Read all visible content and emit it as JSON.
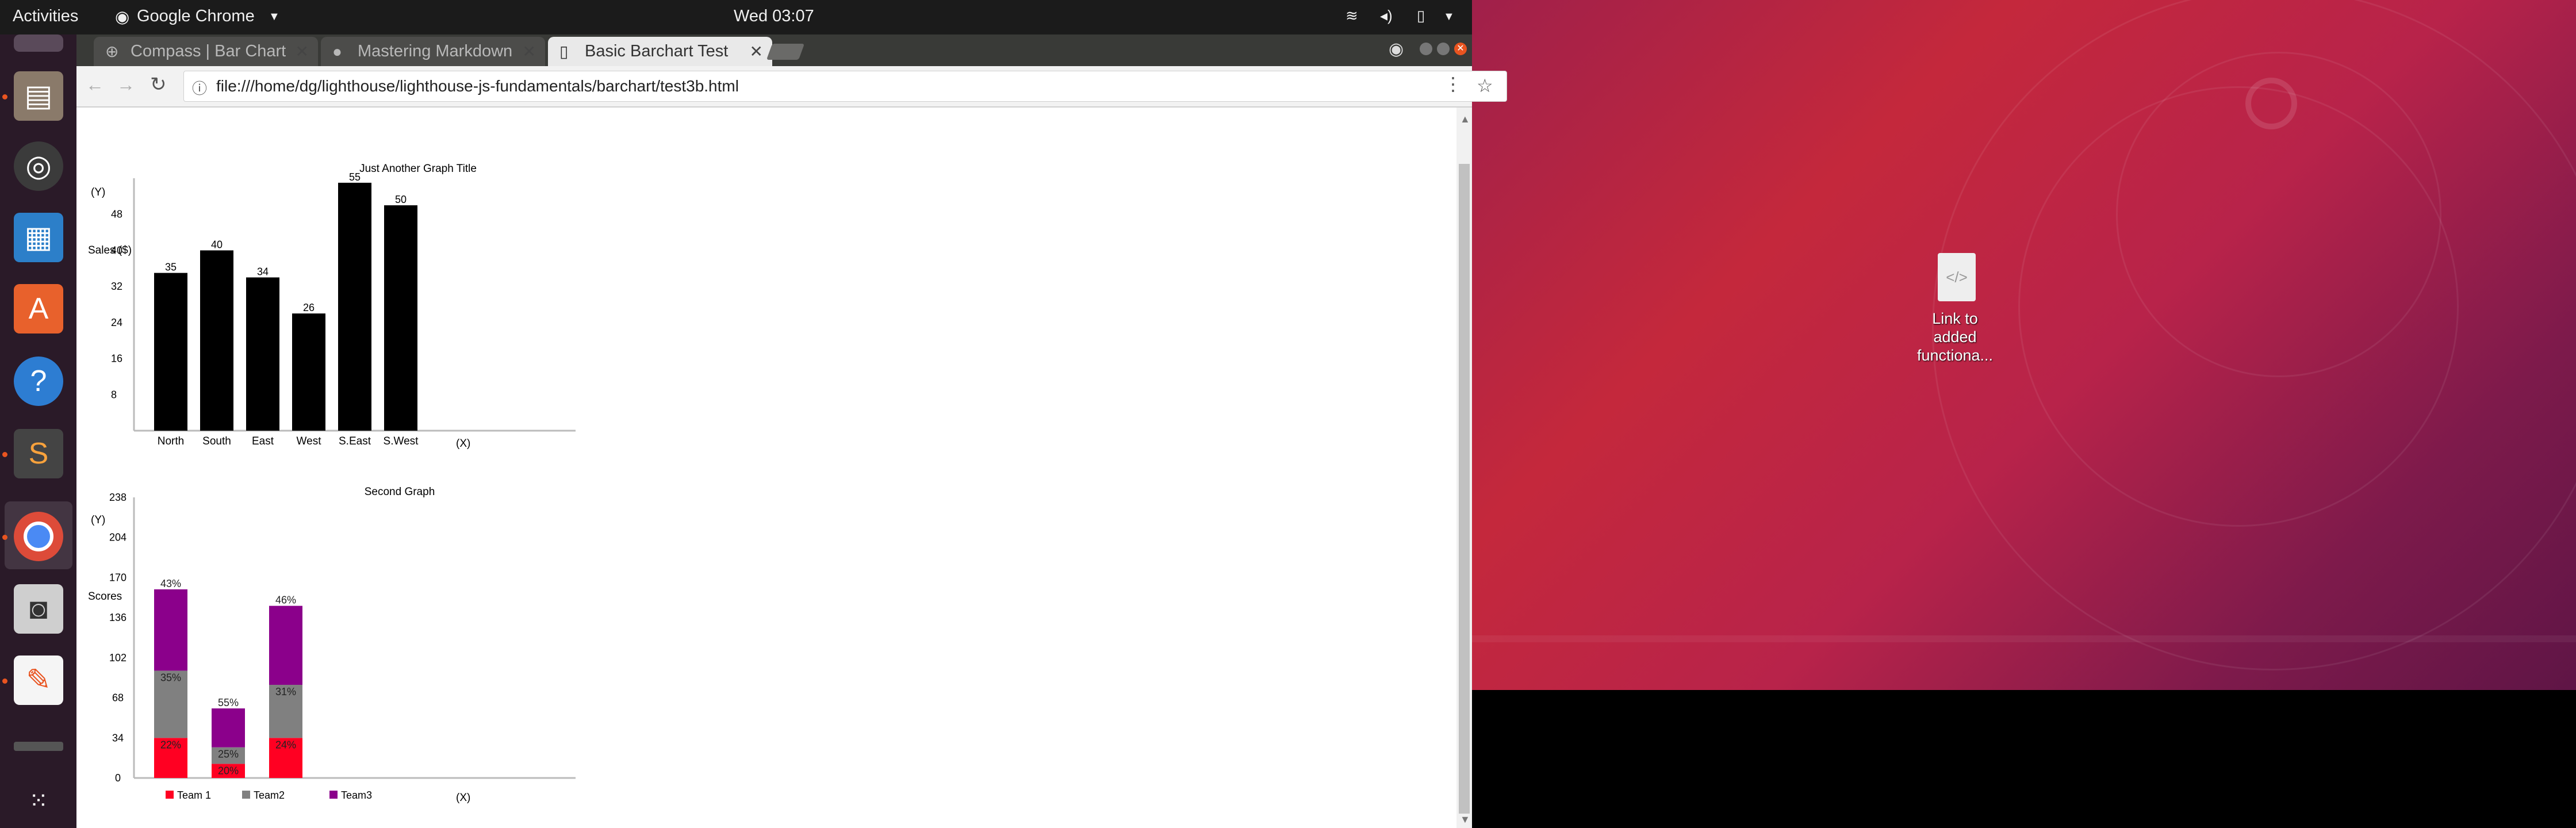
{
  "topbar": {
    "activities": "Activities",
    "app_name": "Google Chrome",
    "clock": "Wed 03:07"
  },
  "browser": {
    "tabs": [
      {
        "label": "Compass | Bar Chart"
      },
      {
        "label": "Mastering Markdown"
      },
      {
        "label": "Basic Barchart Test"
      }
    ],
    "url": "file:///home/dg/lighthouse/lighthouse-js-fundamentals/barchart/test3b.html"
  },
  "desktop": {
    "icon_label_lines": [
      "Link to",
      "added",
      "functiona..."
    ]
  },
  "colors": {
    "desktop_accent": "#c4283c",
    "team1": "#ff0022",
    "team2": "#808080",
    "team3": "#8b008b",
    "bar": "#000000"
  },
  "chart_data": [
    {
      "type": "bar",
      "title": "Just Another Graph Title",
      "ylabel": "Sales ($)",
      "y_marker": "(Y)",
      "x_marker": "(X)",
      "categories": [
        "North",
        "South",
        "East",
        "West",
        "S.East",
        "S.West"
      ],
      "values": [
        35,
        40,
        34,
        26,
        55,
        50
      ],
      "y_ticks": [
        8,
        16,
        24,
        32,
        40,
        48
      ],
      "ylim": [
        0,
        56
      ]
    },
    {
      "type": "bar",
      "stacked": true,
      "title": "Second Graph",
      "ylabel": "Scores",
      "y_marker": "(Y)",
      "x_marker": "(X)",
      "y_ticks": [
        0,
        34,
        68,
        102,
        136,
        170,
        204,
        238
      ],
      "ylim": [
        0,
        238
      ],
      "legend": [
        "Team 1",
        "Team2",
        "Team3"
      ],
      "stacks": [
        {
          "values": [
            34,
            57,
            69
          ],
          "labels": [
            "22%",
            "35%",
            "43%"
          ]
        },
        {
          "values": [
            12,
            14,
            33
          ],
          "labels": [
            "20%",
            "25%",
            "55%"
          ]
        },
        {
          "values": [
            34,
            45,
            67
          ],
          "labels": [
            "24%",
            "31%",
            "46%"
          ]
        }
      ]
    }
  ]
}
